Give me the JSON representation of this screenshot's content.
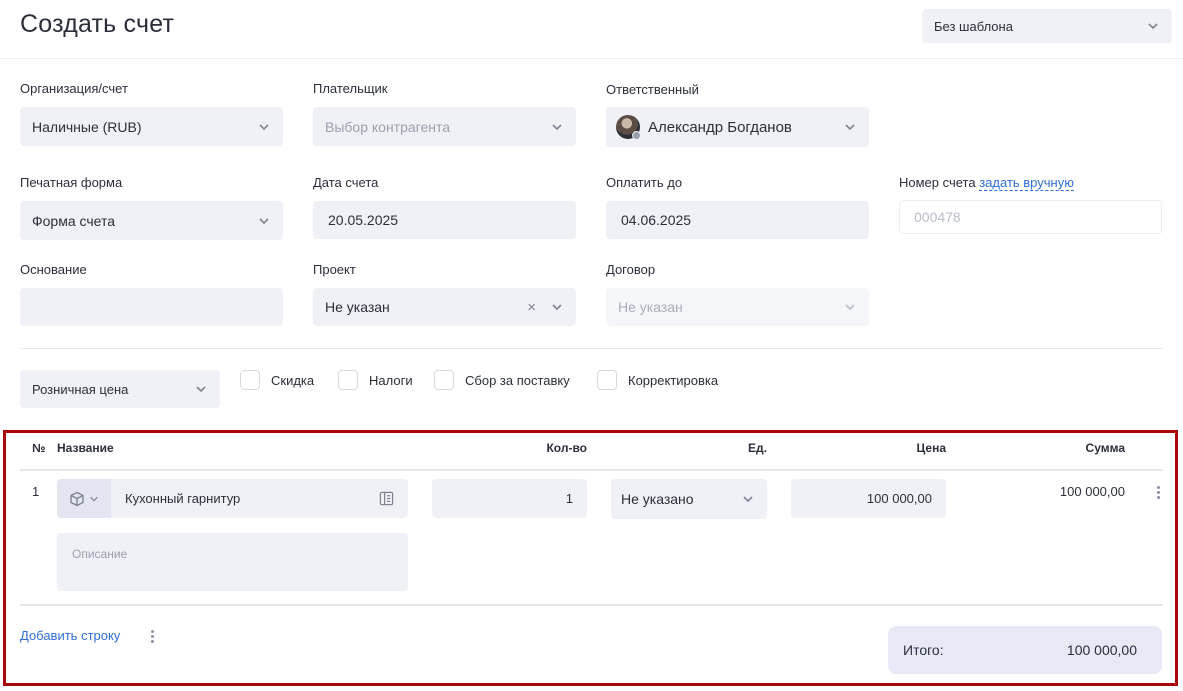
{
  "header": {
    "title": "Создать счет",
    "template_select": "Без шаблона"
  },
  "form": {
    "organization": {
      "label": "Организация/счет",
      "value": "Наличные (RUB)"
    },
    "payer": {
      "label": "Плательщик",
      "placeholder": "Выбор контрагента"
    },
    "responsible": {
      "label": "Ответственный",
      "value": "Александр Богданов"
    },
    "print_form": {
      "label": "Печатная форма",
      "value": "Форма счета"
    },
    "invoice_date": {
      "label": "Дата счета",
      "value": "20.05.2025"
    },
    "pay_until": {
      "label": "Оплатить до",
      "value": "04.06.2025"
    },
    "invoice_number": {
      "label": "Номер счета",
      "link": "задать вручную",
      "placeholder": "000478"
    },
    "basis": {
      "label": "Основание",
      "value": ""
    },
    "project": {
      "label": "Проект",
      "value": "Не указан",
      "clear": "×"
    },
    "contract": {
      "label": "Договор",
      "value": "Не указан"
    }
  },
  "pricing": {
    "price_type": "Розничная цена",
    "options": [
      {
        "label": "Скидка",
        "checked": false
      },
      {
        "label": "Налоги",
        "checked": false
      },
      {
        "label": "Сбор за поставку",
        "checked": false
      },
      {
        "label": "Корректировка",
        "checked": false
      }
    ]
  },
  "table": {
    "headers": {
      "num": "№",
      "name": "Название",
      "qty": "Кол-во",
      "unit": "Ед.",
      "price": "Цена",
      "sum": "Сумма"
    },
    "rows": [
      {
        "num": "1",
        "name": "Кухонный гарнитур",
        "qty": "1",
        "unit": "Не указано",
        "price": "100 000,00",
        "sum": "100 000,00",
        "description_placeholder": "Описание"
      }
    ],
    "add_row": "Добавить строку",
    "total_label": "Итого:",
    "total_value": "100 000,00"
  },
  "colors": {
    "accent": "#2f6fd8",
    "highlight_frame": "#a8080c",
    "field_bg": "#f0f1f6"
  },
  "icons": [
    "chevron-down-icon",
    "cube-icon",
    "catalog-icon",
    "more-vertical-icon",
    "clear-icon",
    "avatar"
  ]
}
